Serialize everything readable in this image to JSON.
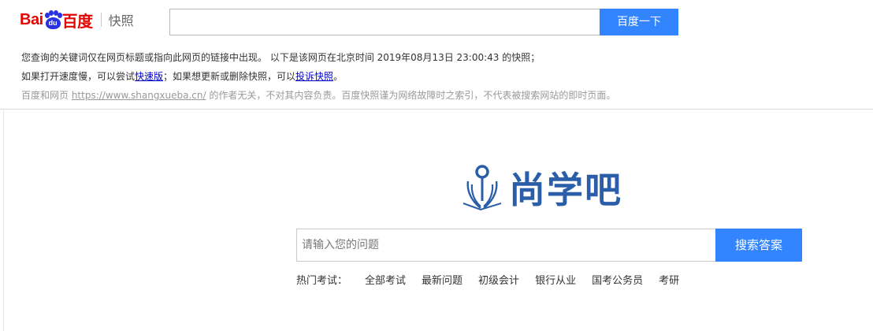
{
  "header": {
    "logo_wordmark_left": "Bai",
    "logo_paw_text": "du",
    "logo_wordmark_right": "百度",
    "product": "快照",
    "search_value": "",
    "search_button": "百度一下"
  },
  "notice": {
    "line1": "您查询的关键词仅在网页标题或指向此网页的链接中出现。  以下是该网页在北京时间 2019年08月13日 23:00:43 的快照；",
    "line2_a": "如果打开速度慢，可以尝试",
    "line2_link1": "快速版",
    "line2_b": "；如果想更新或删除快照，可以",
    "line2_link2": "投诉快照",
    "line2_c": "。",
    "line3_a": "百度和网页 ",
    "line3_url": "https://www.shangxueba.cn/",
    "line3_b": " 的作者无关，不对其内容负责。百度快照谨为网络故障时之索引，不代表被搜索网站的即时页面。"
  },
  "site": {
    "name": "尚学吧",
    "brand_color": "#2a5ea8",
    "search_placeholder": "请输入您的问题",
    "search_button": "搜索答案",
    "hot_label": "热门考试：",
    "hot_items": [
      "全部考试",
      "最新问题",
      "初级会计",
      "银行从业",
      "国考公务员",
      "考研"
    ]
  },
  "colors": {
    "accent": "#3385ff",
    "baidu_red": "#e10602",
    "baidu_blue": "#2932e1",
    "link": "#0000cc"
  }
}
